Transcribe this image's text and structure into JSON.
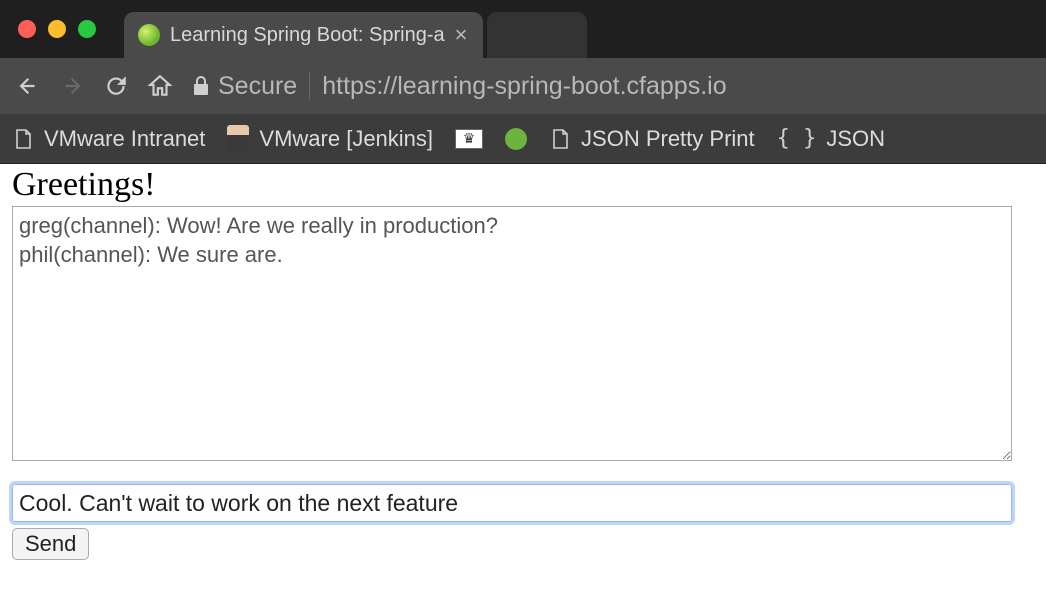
{
  "tab": {
    "title": "Learning Spring Boot: Spring-a"
  },
  "address": {
    "secure_label": "Secure",
    "url": "https://learning-spring-boot.cfapps.io"
  },
  "bookmarks": {
    "items": [
      {
        "label": "VMware Intranet"
      },
      {
        "label": "VMware [Jenkins]"
      },
      {
        "label": ""
      },
      {
        "label": ""
      },
      {
        "label": "JSON Pretty Print"
      },
      {
        "label": "JSON"
      }
    ]
  },
  "page": {
    "heading": "Greetings!",
    "chat_log": "greg(channel): Wow! Are we really in production?\nphil(channel): We sure are.",
    "input_value": "Cool. Can't wait to work on the next feature",
    "send_label": "Send"
  }
}
